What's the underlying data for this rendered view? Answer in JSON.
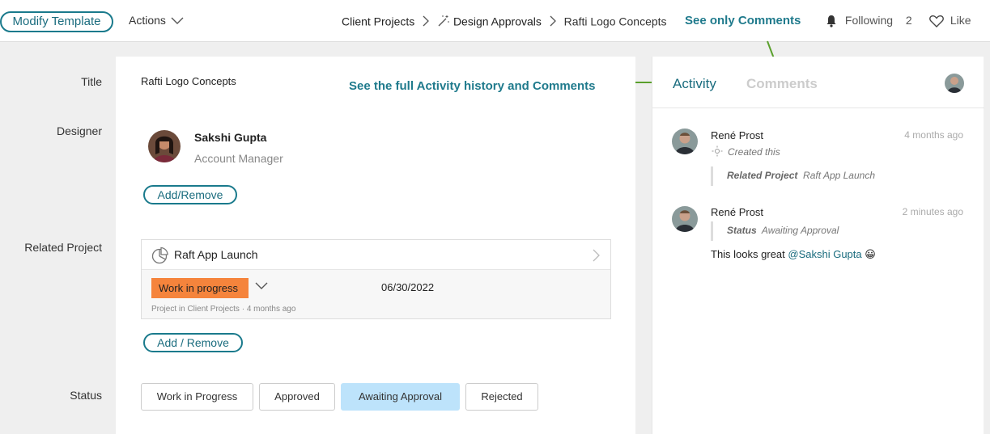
{
  "toolbar": {
    "modify_label": "Modify Template",
    "actions_label": "Actions",
    "breadcrumb": [
      "Client Projects",
      "Design Approvals",
      "Rafti Logo Concepts"
    ],
    "annotation_top": "See only Comments",
    "following_label": "Following",
    "following_count": "2",
    "like_label": "Like"
  },
  "form": {
    "title_label": "Title",
    "title_value": "Rafti Logo Concepts",
    "annotation_mid": "See the full Activity history and Comments",
    "designer_label": "Designer",
    "designer_name": "Sakshi Gupta",
    "designer_role": "Account Manager",
    "add_remove_1": "Add/Remove",
    "related_label": "Related Project",
    "project_name": "Raft App Launch",
    "project_status": "Work in progress",
    "project_date": "06/30/2022",
    "project_meta": "Project in Client Projects · 4 months ago",
    "add_remove_2": "Add / Remove",
    "status_label": "Status",
    "status_options": [
      "Work in Progress",
      "Approved",
      "Awaiting Approval",
      "Rejected"
    ],
    "status_selected": "Awaiting Approval"
  },
  "activity": {
    "tab_activity": "Activity",
    "tab_comments": "Comments",
    "entries": [
      {
        "author": "René Prost",
        "time": "4 months ago",
        "action": "Created this",
        "field": "Related Project",
        "value": "Raft App Launch"
      },
      {
        "author": "René Prost",
        "time": "2 minutes ago",
        "field": "Status",
        "value": "Awaiting Approval",
        "comment": "This looks great",
        "mention": "@Sakshi Gupta",
        "emoji": "😀"
      }
    ]
  },
  "colors": {
    "accent": "#1a6c7e",
    "annotation": "#1f7a8c",
    "arrow": "#5aa02c",
    "status_orange": "#f5843c",
    "selected_blue": "#bde3fb"
  }
}
